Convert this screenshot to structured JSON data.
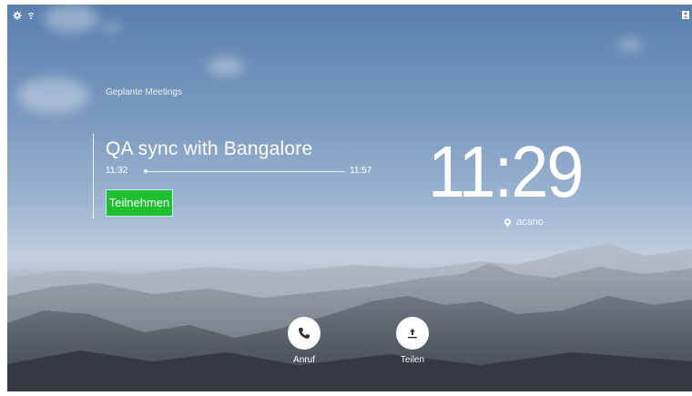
{
  "meeting": {
    "section_label": "Geplante Meetings",
    "title": "QA sync with Bangalore",
    "start_time": "11:32",
    "end_time": "11:57",
    "join_label": "Teilnehmen"
  },
  "clock": {
    "time": "11:29",
    "location": "acano"
  },
  "actions": [
    {
      "label": "Anruf",
      "icon": "phone-icon"
    },
    {
      "label": "Teilen",
      "icon": "share-upload-icon"
    }
  ],
  "status_icons": [
    "gear-icon",
    "wifi-icon",
    "user-icon"
  ],
  "colors": {
    "join_button": "#1ec02e",
    "text": "#ffffff"
  }
}
